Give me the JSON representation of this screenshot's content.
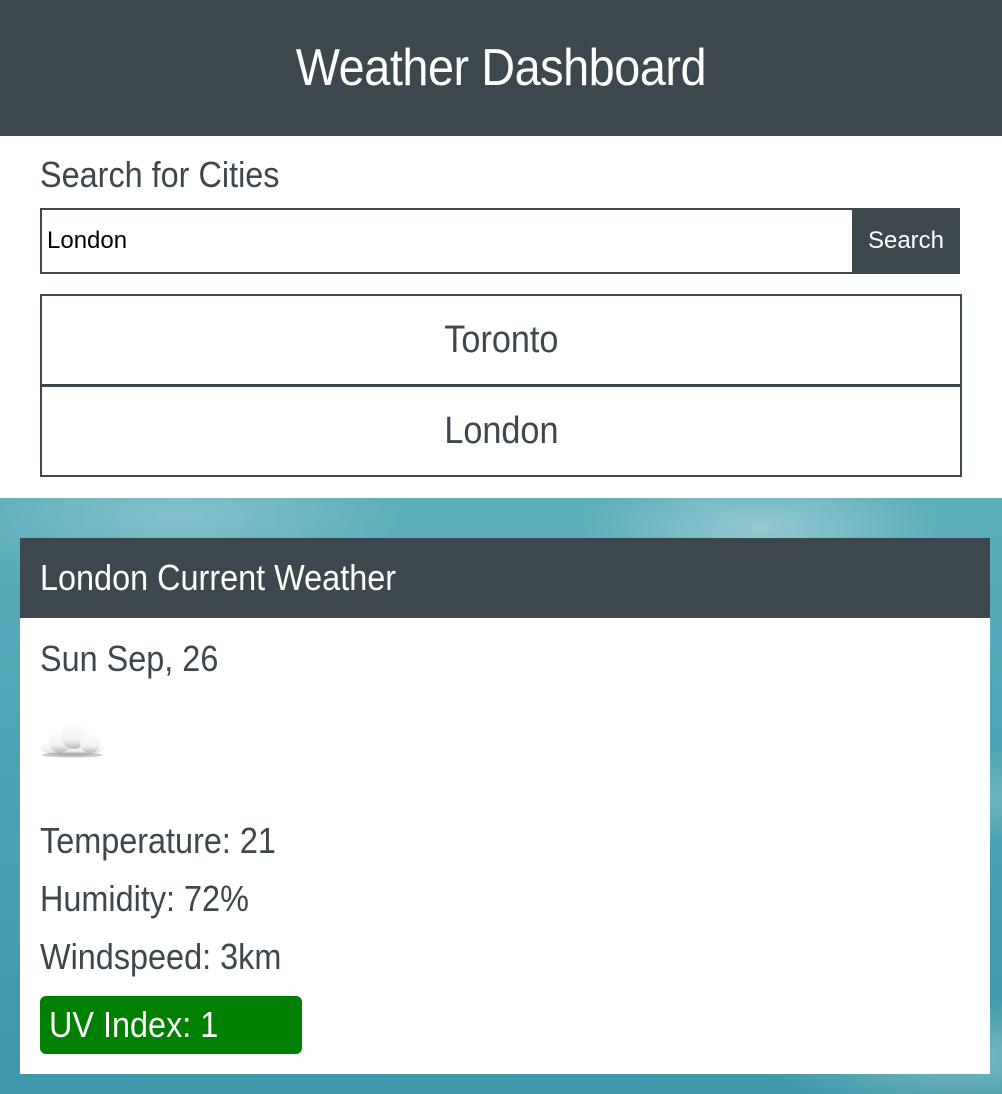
{
  "header": {
    "title": "Weather Dashboard"
  },
  "search": {
    "label": "Search for Cities",
    "input_value": "London",
    "button_label": "Search"
  },
  "history": [
    {
      "label": "Toronto"
    },
    {
      "label": "London"
    }
  ],
  "current": {
    "title": "London Current Weather",
    "date": "Sun Sep, 26",
    "icon": "cloud-icon",
    "temperature": "Temperature: 21",
    "humidity": "Humidity: 72%",
    "windspeed": "Windspeed: 3km",
    "uv_index": "UV Index: 1",
    "uv_color": "#008000"
  },
  "colors": {
    "primary": "#3c474e",
    "background_sky": "#4aa2b2"
  }
}
